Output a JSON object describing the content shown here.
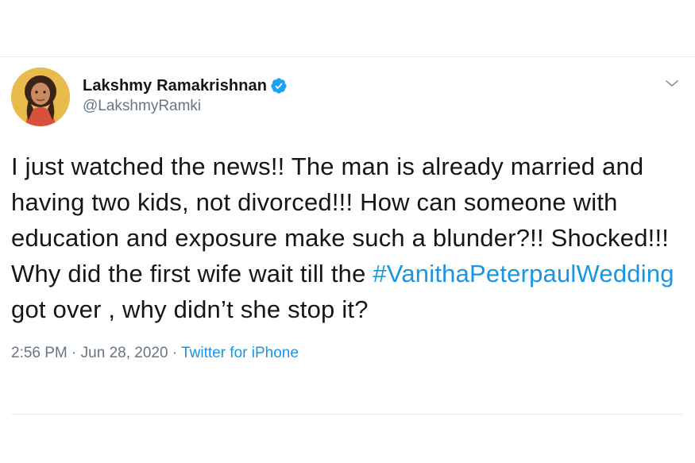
{
  "tweet": {
    "author": {
      "display_name": "Lakshmy Ramakrishnan",
      "handle": "@LakshmyRamki",
      "verified": true,
      "avatar_icon": "profile-photo"
    },
    "text_parts": {
      "before_hashtag": "I just watched the news!! The man is already married and having two kids, not divorced!!! How can someone with education and exposure make such a blunder?!! Shocked!!! Why did the first wife wait till the ",
      "hashtag": "#VanithaPeterpaulWedding",
      "after_hashtag": " got over , why didn’t she stop it?"
    },
    "meta": {
      "time": "2:56 PM",
      "separator1": " · ",
      "date": "Jun 28, 2020",
      "separator2": " · ",
      "source": "Twitter for iPhone"
    },
    "menu_icon": "chevron-down-icon"
  },
  "colors": {
    "link": "#1b95e0",
    "secondary_text": "#657786",
    "primary_text": "#14171a",
    "divider": "#e6ecf0",
    "verified_badge": "#1da1f2"
  }
}
